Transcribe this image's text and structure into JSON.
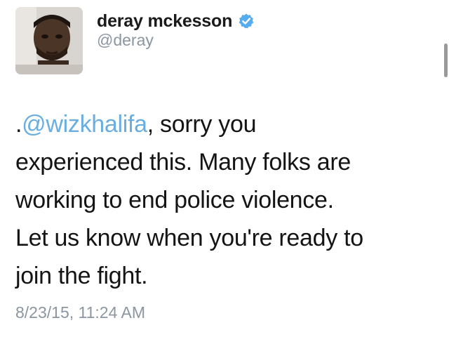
{
  "author": {
    "display_name": "deray mckesson",
    "handle": "@deray",
    "verified": true,
    "verified_icon": "verified-badge-icon",
    "avatar_icon": "profile-avatar"
  },
  "tweet": {
    "prefix": ".",
    "mention": "@wizkhalifa",
    "line1_rest": ", sorry you",
    "line2": "experienced this. Many folks are",
    "line3": "working to end police violence.",
    "line4": "Let us know when you're ready to",
    "line5": "join the fight.",
    "timestamp": "8/23/15, 11:24 AM"
  },
  "colors": {
    "mention": "#6aaee0",
    "verified": "#55acee",
    "secondary_text": "#8b96a0"
  }
}
